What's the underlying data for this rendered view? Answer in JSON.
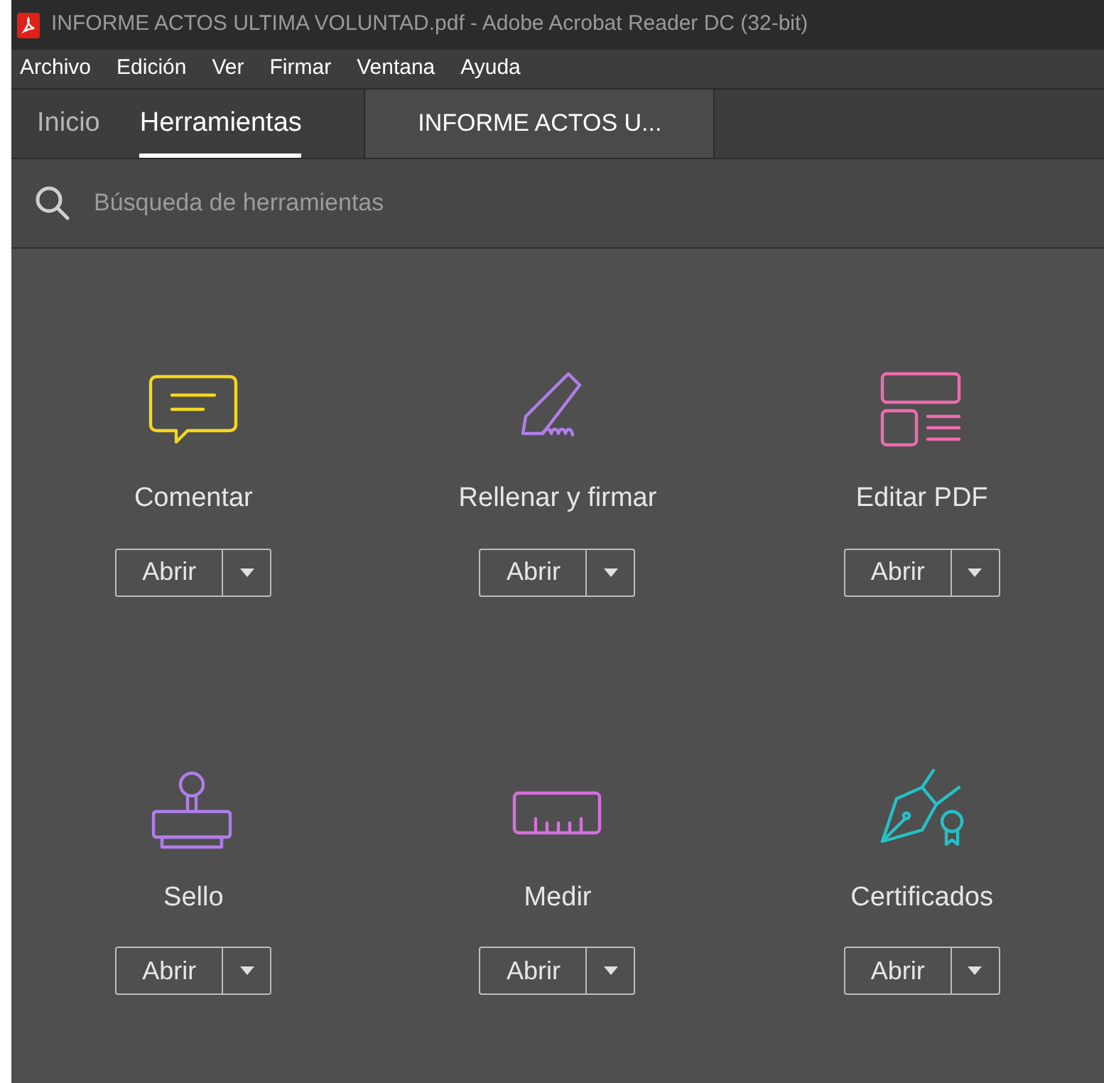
{
  "window": {
    "title": "INFORME ACTOS ULTIMA VOLUNTAD.pdf - Adobe Acrobat Reader DC (32-bit)"
  },
  "menu": [
    "Archivo",
    "Edición",
    "Ver",
    "Firmar",
    "Ventana",
    "Ayuda"
  ],
  "tabs": [
    {
      "label": "Inicio",
      "selected": false
    },
    {
      "label": "Herramientas",
      "selected": true
    }
  ],
  "document_tab": {
    "label": "INFORME ACTOS U..."
  },
  "search": {
    "placeholder": "Búsqueda de herramientas"
  },
  "tools": [
    {
      "kind": "comment",
      "name": "Comentar",
      "color": "#f5d81e",
      "button": "Abrir"
    },
    {
      "kind": "sign",
      "name": "Rellenar y firmar",
      "color": "#b07ee8",
      "button": "Abrir"
    },
    {
      "kind": "edit",
      "name": "Editar PDF",
      "color": "#ef6bb0",
      "button": "Abrir"
    },
    {
      "kind": "stamp",
      "name": "Sello",
      "color": "#b07ee8",
      "button": "Abrir"
    },
    {
      "kind": "measure",
      "name": "Medir",
      "color": "#d66fe0",
      "button": "Abrir"
    },
    {
      "kind": "certificate",
      "name": "Certificados",
      "color": "#26c0c7",
      "button": "Abrir"
    }
  ]
}
